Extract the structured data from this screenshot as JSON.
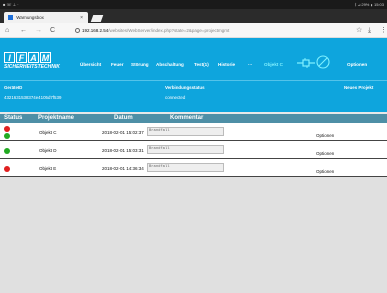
{
  "statusbar": {
    "left": "■ ☏ ⊥ ·",
    "right": "ᛒ ⊿ 29% ▮ 15:03"
  },
  "browser": {
    "tab_title": "Warnungsbox",
    "tab_close": "×",
    "url_host": "192.168.2.54",
    "url_path": "/websites/WebServer/index.php?state=2&page=projectmgmt",
    "back": "←",
    "forward": "→",
    "reload": "C",
    "home": "⌂",
    "star": "☆",
    "download": "⤓",
    "menu": "⋮"
  },
  "app": {
    "logo_letters": [
      "I",
      "F",
      "A",
      "M"
    ],
    "logo_sub": "SICHERHEITSTECHNIK",
    "nav": [
      "Übersicht",
      "Feuer",
      "Störung",
      "Abschaltung",
      "Test(1)",
      "Historie",
      "···",
      "Objekt C"
    ],
    "options": "Optionen"
  },
  "info": {
    "device_label": "GeräteID",
    "device_value": "4321631538374e4105d7f539",
    "conn_label": "Verbindungsstatus",
    "conn_value": "connected",
    "new_project": "Neues Projekt"
  },
  "table": {
    "headers": [
      "Status",
      "Projektname",
      "Datum",
      "Kommentar"
    ],
    "rows": [
      {
        "name": "Objekt C",
        "date": "2018-02-01 15:02:37",
        "comment": "Brandfall",
        "options": "Optionen",
        "status_colors": [
          "#e02020",
          "#22aa22"
        ]
      },
      {
        "name": "Objekt D",
        "date": "2018-02-01 15:03:31",
        "comment": "Brandfall",
        "options": "Optionen",
        "status_colors": [
          "#22aa22"
        ]
      },
      {
        "name": "Objekt E",
        "date": "2018-02-01 14:36:34",
        "comment": "Brandfall",
        "options": "Optionen",
        "status_colors": [
          "#e02020"
        ]
      }
    ]
  },
  "colors": {
    "header": "#0ea5dd",
    "table_head": "#4e8fa6"
  }
}
